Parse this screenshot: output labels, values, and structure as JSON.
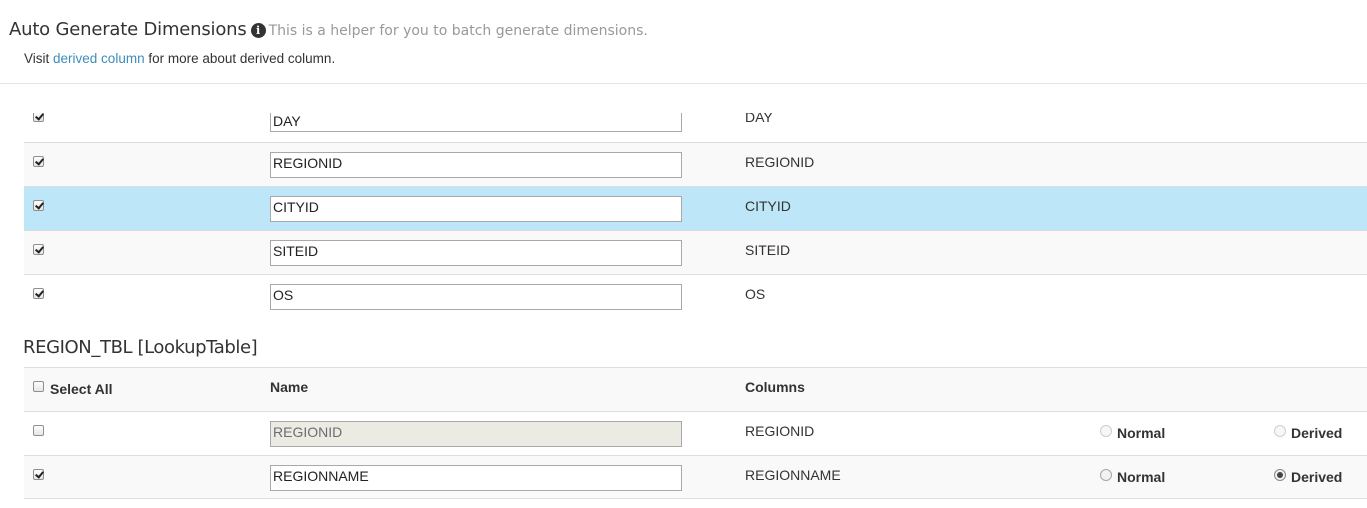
{
  "header": {
    "title": "Auto Generate Dimensions",
    "info_icon": "info-icon",
    "helper_text": "This is a helper for you to batch generate dimensions.",
    "visit_prefix": "Visit",
    "visit_link": "derived column",
    "visit_suffix": "for more about derived column."
  },
  "fact_rows": [
    {
      "checked": true,
      "name": "DAY",
      "column": "DAY"
    },
    {
      "checked": true,
      "name": "REGIONID",
      "column": "REGIONID"
    },
    {
      "checked": true,
      "name": "CITYID",
      "column": "CITYID"
    },
    {
      "checked": true,
      "name": "SITEID",
      "column": "SITEID"
    },
    {
      "checked": true,
      "name": "OS",
      "column": "OS"
    }
  ],
  "lookup": {
    "title": "REGION_TBL [LookupTable]",
    "headers": {
      "select_all": "Select All",
      "name": "Name",
      "columns": "Columns"
    },
    "rows": [
      {
        "checked": false,
        "name": "REGIONID",
        "name_disabled": true,
        "column": "REGIONID",
        "normal_label": "Normal",
        "derived_label": "Derived",
        "selected": "none"
      },
      {
        "checked": true,
        "name": "REGIONNAME",
        "name_disabled": false,
        "column": "REGIONNAME",
        "normal_label": "Normal",
        "derived_label": "Derived",
        "selected": "Derived"
      }
    ]
  },
  "colors": {
    "highlight_row": "#bde6f8",
    "link": "#3c8dbc",
    "stripe": "#f9f9f9"
  }
}
